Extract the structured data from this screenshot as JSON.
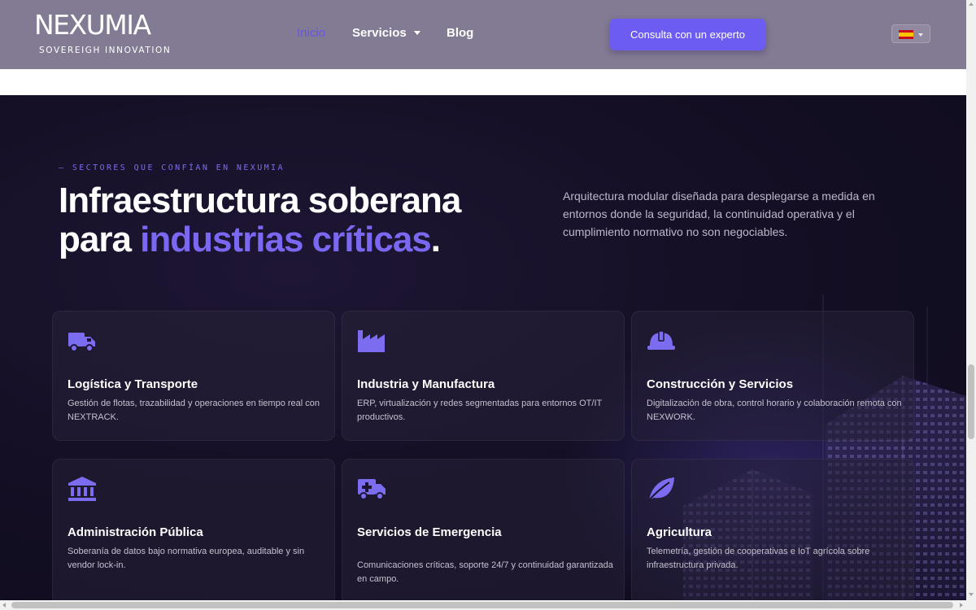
{
  "header": {
    "logo_word": "NEXUMIA",
    "logo_tagline": "SOVEREIGH INNOVATION",
    "nav": [
      {
        "label": "Inicio",
        "active": true
      },
      {
        "label": "Servicios",
        "active": false
      },
      {
        "label": "Blog",
        "active": false
      }
    ],
    "cta_label": "Consulta con un experto",
    "language_flag": "spain-flag-icon"
  },
  "hero": {
    "eyebrow": "— SECTORES QUE CONFÍAN EN NEXUMIA",
    "headline_line1": "Infraestructura soberana",
    "headline_line2_prefix": "para ",
    "headline_line2_accent": "industrias críticas",
    "headline_line2_suffix": ".",
    "lead": "Arquitectura modular diseñada para desplegarse a medida en entornos donde la seguridad, la continuidad operativa y el cumplimiento normativo no son negociables."
  },
  "sectors": [
    {
      "icon": "truck-icon",
      "title": "Logística y Transporte",
      "description": "Gestión de flotas, trazabilidad y operaciones en tiempo real con NEXTRACK."
    },
    {
      "icon": "factory-icon",
      "title": "Industria y Manufactura",
      "description": "ERP, virtualización y redes segmentadas para entornos OT/IT productivos."
    },
    {
      "icon": "hard-hat-icon",
      "title": "Construcción y Servicios",
      "description": "Digitalización de obra, control horario y colaboración remota con NEXWORK."
    },
    {
      "icon": "landmark-icon",
      "title": "Administración Pública",
      "description": "Soberanía de datos bajo normativa europea, auditable y sin vendor lock-in."
    },
    {
      "icon": "ambulance-icon",
      "title": "Servicios de Emergencia",
      "description": "Comunicaciones críticas, soporte 24/7 y continuidad garantizada en campo."
    },
    {
      "icon": "leaf-icon",
      "title": "Agricultura",
      "description": "Telemetría, gestión de cooperativas e IoT agrícola sobre infraestructura privada."
    }
  ],
  "colors": {
    "accent": "#6d5cf2",
    "header_bg": "#837a93",
    "hero_bg": "#140f24",
    "icon": "#7b6cf0"
  }
}
